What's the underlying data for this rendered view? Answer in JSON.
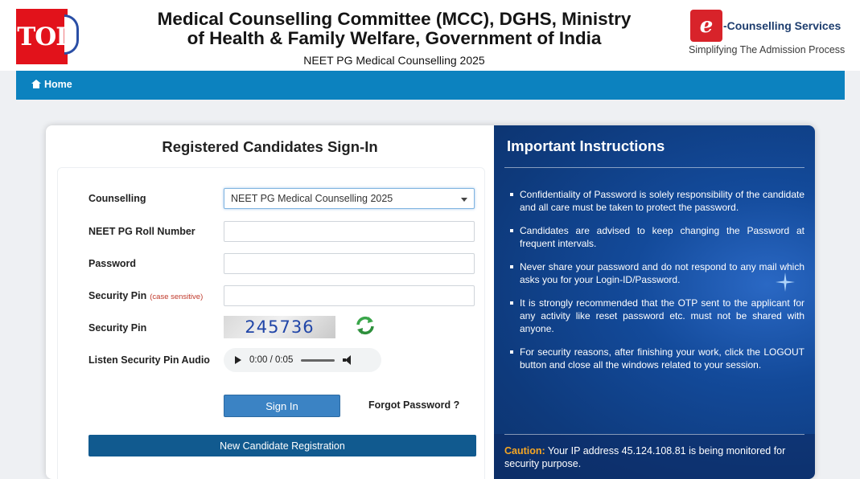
{
  "header": {
    "watermark": "TOI",
    "title_line1": "Medical Counselling Committee (MCC), DGHS, Ministry",
    "title_line2": "of Health & Family Welfare, Government of India",
    "subtitle": "NEET PG Medical Counselling 2025",
    "ecs_name": "-Counselling Services",
    "ecs_tagline": "Simplifying The Admission Process"
  },
  "nav": {
    "home_label": "Home"
  },
  "signin": {
    "title": "Registered Candidates Sign-In",
    "counselling_label": "Counselling",
    "counselling_value": "NEET PG Medical Counselling 2025",
    "roll_label": "NEET PG Roll Number",
    "roll_value": "",
    "password_label": "Password",
    "password_value": "",
    "pin_input_label": "Security Pin",
    "pin_hint": "(case sensitive)",
    "pin_input_value": "",
    "pin_label": "Security Pin",
    "captcha_text": "245736",
    "audio_label": "Listen Security Pin Audio",
    "audio_time": "0:00 / 0:05",
    "signin_button": "Sign In",
    "forgot_link": "Forgot Password ?",
    "new_registration_button": "New Candidate Registration"
  },
  "instructions": {
    "title": "Important Instructions",
    "items": [
      "Confidentiality of Password is solely responsibility of the candidate and all care must be taken to protect the password.",
      "Candidates are advised to keep changing the Password at frequent intervals.",
      "Never share your password and do not respond to any mail which asks you for your Login-ID/Password.",
      "It is strongly recommended that the OTP sent to the applicant for any activity like reset password etc. must not be shared with anyone.",
      "For security reasons, after finishing your work, click the LOGOUT button and close all the windows related to your session."
    ],
    "caution_label": "Caution:",
    "caution_text": " Your IP address 45.124.108.81 is being monitored for security purpose."
  },
  "colors": {
    "nav_bar": "#0c82bf",
    "signin_button": "#3b83c4",
    "new_registration_button": "#115a8f",
    "instructions_bg": "#134a9a",
    "caution_label": "#f5a623",
    "captcha_text": "#2146a8"
  }
}
